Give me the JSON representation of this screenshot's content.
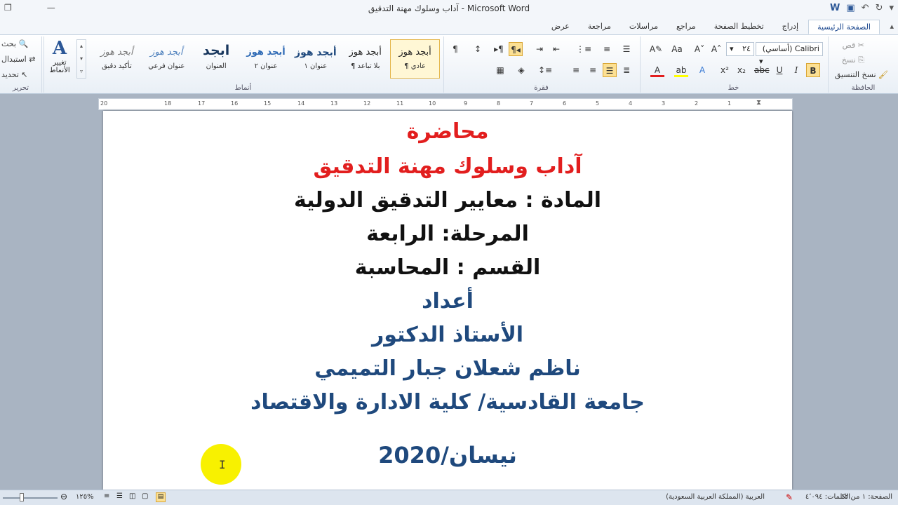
{
  "window": {
    "title": "آداب وسلوك مهنة التدقيق  -  Microsoft Word",
    "restore_icon": "restore-window-icon",
    "minimize_icon": "minimize-icon"
  },
  "tabs": [
    {
      "label": "الصفحة الرئيسية",
      "active": true
    },
    {
      "label": "إدراج"
    },
    {
      "label": "تخطيط الصفحة"
    },
    {
      "label": "مراجع"
    },
    {
      "label": "مراسلات"
    },
    {
      "label": "مراجعة"
    },
    {
      "label": "عرض"
    }
  ],
  "ribbon": {
    "clipboard": {
      "label": "الحافظة",
      "paste": "لصق",
      "cut": "قص",
      "copy": "نسخ",
      "format_painter": "نسخ التنسيق"
    },
    "font": {
      "label": "خط",
      "font_name": "Calibri (أساسي)",
      "font_size": "٢٤"
    },
    "paragraph": {
      "label": "فقرة"
    },
    "styles": {
      "label": "أنماط",
      "items": [
        {
          "sample": "أبجد هوز",
          "name": "¶ عادي"
        },
        {
          "sample": "أبجد هوز",
          "name": "¶ بلا تباعد"
        },
        {
          "sample": "أبجد هوز",
          "name": "عنوان ١"
        },
        {
          "sample": "أبجد هوز",
          "name": "عنوان ٢"
        },
        {
          "sample": "ابجد",
          "name": "العنوان"
        },
        {
          "sample": "أبجد هوز",
          "name": "عنوان فرعي"
        },
        {
          "sample": "أبجد هوز",
          "name": "تأكيد دقيق"
        }
      ],
      "change_styles": "تغيير الأنماط"
    },
    "editing": {
      "label": "تحرير",
      "find": "بحث",
      "replace": "استبدال",
      "select": "تحديد"
    }
  },
  "ruler": {
    "ticks": [
      "20",
      "18",
      "17",
      "16",
      "15",
      "14",
      "13",
      "12",
      "11",
      "10",
      "9",
      "8",
      "7",
      "6",
      "5",
      "4",
      "3",
      "2",
      "1"
    ]
  },
  "document": {
    "lines": [
      {
        "text": "محاضرة",
        "color": "#e21e1e"
      },
      {
        "text": "آداب وسلوك مهنة التدقيق",
        "color": "#e21e1e"
      },
      {
        "text": "المادة : معايير التدقيق الدولية",
        "color": "#111111"
      },
      {
        "text": "المرحلة: الرابعة",
        "color": "#111111"
      },
      {
        "text": "القسم : المحاسبة",
        "color": "#111111"
      },
      {
        "text": "أعداد",
        "color": "#1f497d"
      },
      {
        "text": "الأستاذ الدكتور",
        "color": "#1f497d"
      },
      {
        "text": "ناظم شعلان جبار التميمي",
        "color": "#1f497d"
      },
      {
        "text": "جامعة القادسية/ كلية الادارة والاقتصاد",
        "color": "#1f497d"
      },
      {
        "text": "نيسان/2020",
        "color": "#1f497d"
      }
    ]
  },
  "statusbar": {
    "page": "الصفحة: ١ من ١٢",
    "words": "الكلمات: ٤٬٠٩٤",
    "language": "العربية (المملكة العربية السعودية)",
    "zoom": "١٢٥%"
  }
}
